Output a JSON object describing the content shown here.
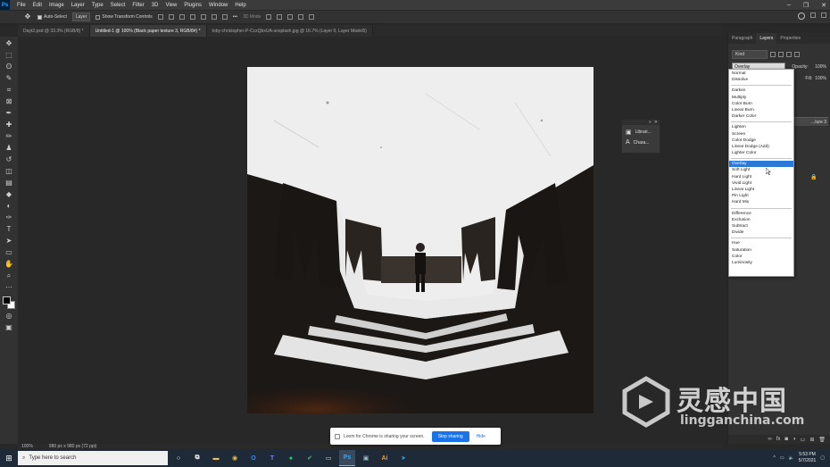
{
  "app": {
    "logo_text": "Ps"
  },
  "menu": [
    "File",
    "Edit",
    "Image",
    "Layer",
    "Type",
    "Select",
    "Filter",
    "3D",
    "View",
    "Plugins",
    "Window",
    "Help"
  ],
  "options": {
    "auto_select_label": "Auto-Select",
    "layer_value": "Layer",
    "transform_label": "Show Transform Controls",
    "mode_3d_label": "3D Mode"
  },
  "tabs": [
    {
      "label": "Dayt2.psd @ 33.3% (RGB/8) *",
      "active": false
    },
    {
      "label": "Untitled-1 @ 100% (Black paper texture 3, RGB/8#) *",
      "active": true
    },
    {
      "label": "toby-christopher-P-CcxQbxUA-unsplash.jpg @ 16.7% (Layer 0, Layer Mask/8)",
      "active": false
    }
  ],
  "tools": [
    "move-icon",
    "marquee-icon",
    "lasso-icon",
    "quick-select-icon",
    "crop-icon",
    "frame-icon",
    "eyedropper-icon",
    "healing-icon",
    "brush-icon",
    "stamp-icon",
    "history-brush-icon",
    "eraser-icon",
    "gradient-icon",
    "blur-icon",
    "dodge-icon",
    "pen-icon",
    "type-icon",
    "path-select-icon",
    "shape-icon",
    "hand-icon",
    "zoom-icon",
    "more-tools-icon"
  ],
  "tool_glyphs": [
    "✥",
    "⬚",
    "ʘ",
    "✎",
    "⌗",
    "⊠",
    "✒",
    "✚",
    "✏",
    "♟",
    "↺",
    "◫",
    "▤",
    "◆",
    "◐",
    "✑",
    "T",
    "➤",
    "▭",
    "✋",
    "⌕",
    "⋯"
  ],
  "float_panel": {
    "items": [
      "Librari...",
      "Chara..."
    ]
  },
  "panels": {
    "tabs": [
      "Paragraph",
      "Layers",
      "Properties"
    ],
    "active_tab": "Layers",
    "kind_label": "Kind",
    "blend_value": "Overlay",
    "opacity_label": "Opacity:",
    "opacity_value": "100%",
    "fill_label": "Fill:",
    "fill_value": "100%",
    "layer_stub": "...ture 3"
  },
  "blend_modes": {
    "groups": [
      [
        "Normal",
        "Dissolve"
      ],
      [
        "Darken",
        "Multiply",
        "Color Burn",
        "Linear Burn",
        "Darker Color"
      ],
      [
        "Lighten",
        "Screen",
        "Color Dodge",
        "Linear Dodge (Add)",
        "Lighter Color"
      ],
      [
        "Overlay",
        "Soft Light",
        "Hard Light",
        "Vivid Light",
        "Linear Light",
        "Pin Light",
        "Hard Mix"
      ],
      [
        "Difference",
        "Exclusion",
        "Subtract",
        "Divide"
      ],
      [
        "Hue",
        "Saturation",
        "Color",
        "Luminosity"
      ]
    ],
    "selected": "Overlay"
  },
  "status": {
    "zoom": "100%",
    "doc_size": "980 px x 980 px (72 ppi)"
  },
  "loom": {
    "message": "Loom for Chrome is sharing your screen.",
    "stop_label": "Stop sharing",
    "hide_label": "Hide"
  },
  "taskbar": {
    "search_placeholder": "Type here to search",
    "time": "5:53 PM",
    "date": "5/7/2021"
  },
  "watermark": {
    "cn": "灵感中国",
    "en": "lingganchina.com"
  },
  "colors": {
    "accent_blue": "#2b78d6",
    "loom_blue": "#1a73e8",
    "ps_blue": "#31a8ff"
  }
}
